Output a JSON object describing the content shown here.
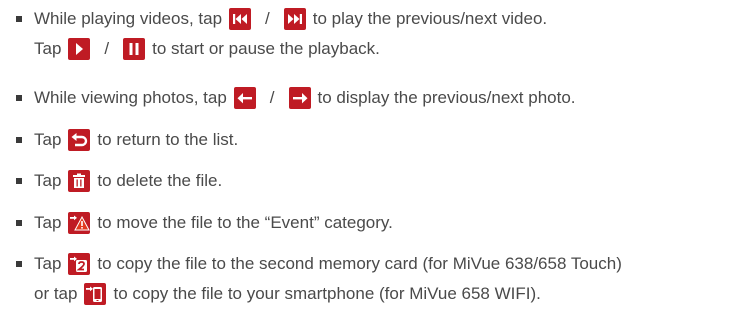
{
  "items": [
    {
      "lines": [
        [
          "While playing videos, tap",
          "/",
          "to play the previous/next video."
        ],
        [
          "Tap",
          "/",
          "to start or pause the playback."
        ]
      ],
      "icons": [
        "skip-previous-icon",
        "skip-next-icon",
        "play-icon",
        "pause-icon"
      ]
    },
    {
      "lines": [
        [
          "While viewing photos, tap",
          "/",
          "to display the previous/next photo."
        ]
      ],
      "icons": [
        "arrow-left-icon",
        "arrow-right-icon"
      ]
    },
    {
      "lines": [
        [
          "Tap",
          "to return to the list."
        ]
      ],
      "icons": [
        "return-icon"
      ]
    },
    {
      "lines": [
        [
          "Tap",
          "to delete the file."
        ]
      ],
      "icons": [
        "trash-icon"
      ]
    },
    {
      "lines": [
        [
          "Tap",
          "to move the file to the “Event” category."
        ]
      ],
      "icons": [
        "move-to-event-icon"
      ]
    },
    {
      "lines": [
        [
          "Tap",
          "to copy the file to the second memory card (for MiVue 638/658 Touch)"
        ],
        [
          "or tap",
          "to copy the file to your smartphone (for MiVue 658 WIFI)."
        ]
      ],
      "icons": [
        "copy-to-card-2-icon",
        "copy-to-smartphone-icon"
      ]
    }
  ],
  "colors": {
    "icon_bg": "#bf1b24",
    "text": "#4a4a4a",
    "bullet": "#3a3a3a"
  }
}
